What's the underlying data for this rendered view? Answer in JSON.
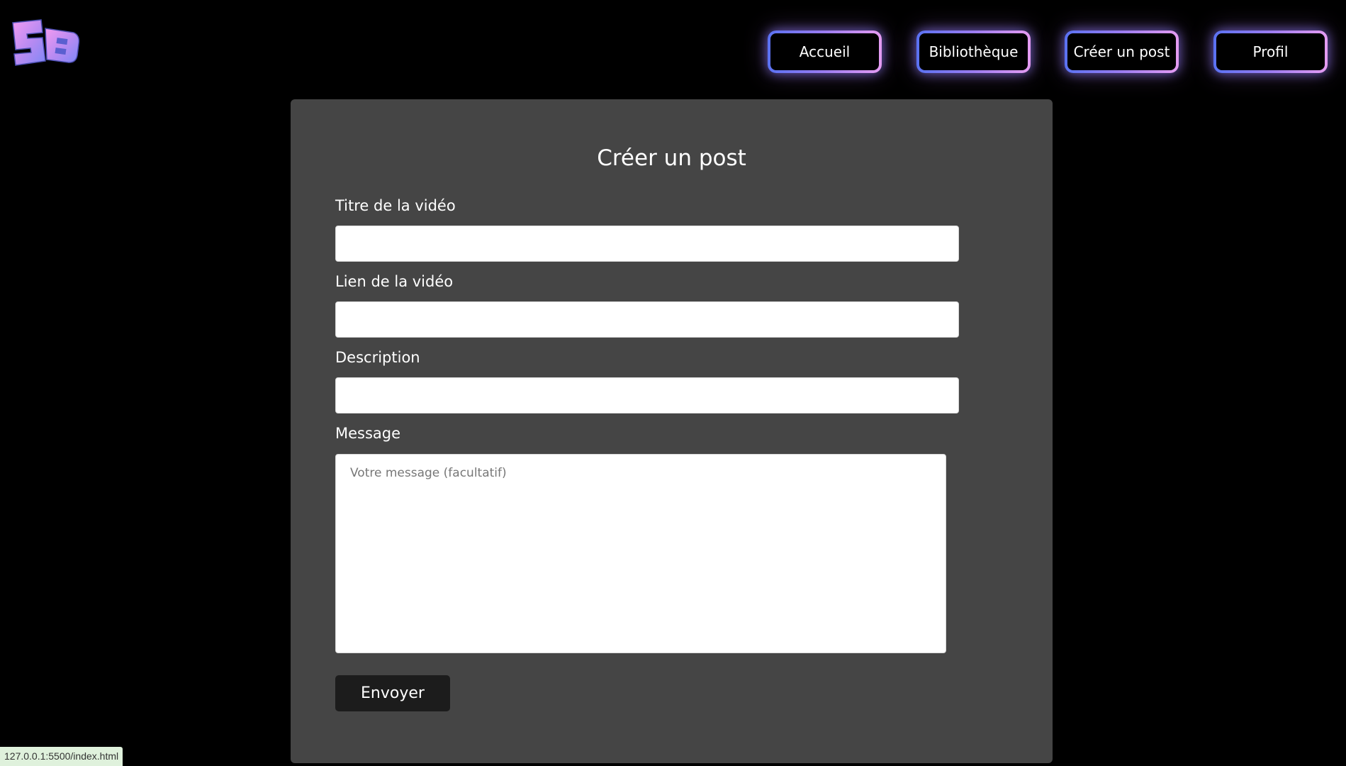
{
  "nav": {
    "items": [
      {
        "label": "Accueil"
      },
      {
        "label": "Bibliothèque"
      },
      {
        "label": "Créer un post"
      },
      {
        "label": "Profil"
      }
    ]
  },
  "form": {
    "title": "Créer un post",
    "fields": [
      {
        "label": "Titre de la vidéo",
        "value": ""
      },
      {
        "label": "Lien de la vidéo",
        "value": ""
      },
      {
        "label": "Description",
        "value": ""
      }
    ],
    "message": {
      "label": "Message",
      "placeholder": "Votre message (facultatif)",
      "value": ""
    },
    "submit_label": "Envoyer"
  },
  "status_bar": {
    "url": "127.0.0.1:5500/index.html"
  },
  "colors": {
    "background": "#000000",
    "card": "#454545",
    "submit": "#1c1c1c",
    "nav_gradient_start": "#5a72f2",
    "nav_gradient_end": "#e59cf2"
  },
  "icons": {
    "logo": "sb-logo"
  }
}
